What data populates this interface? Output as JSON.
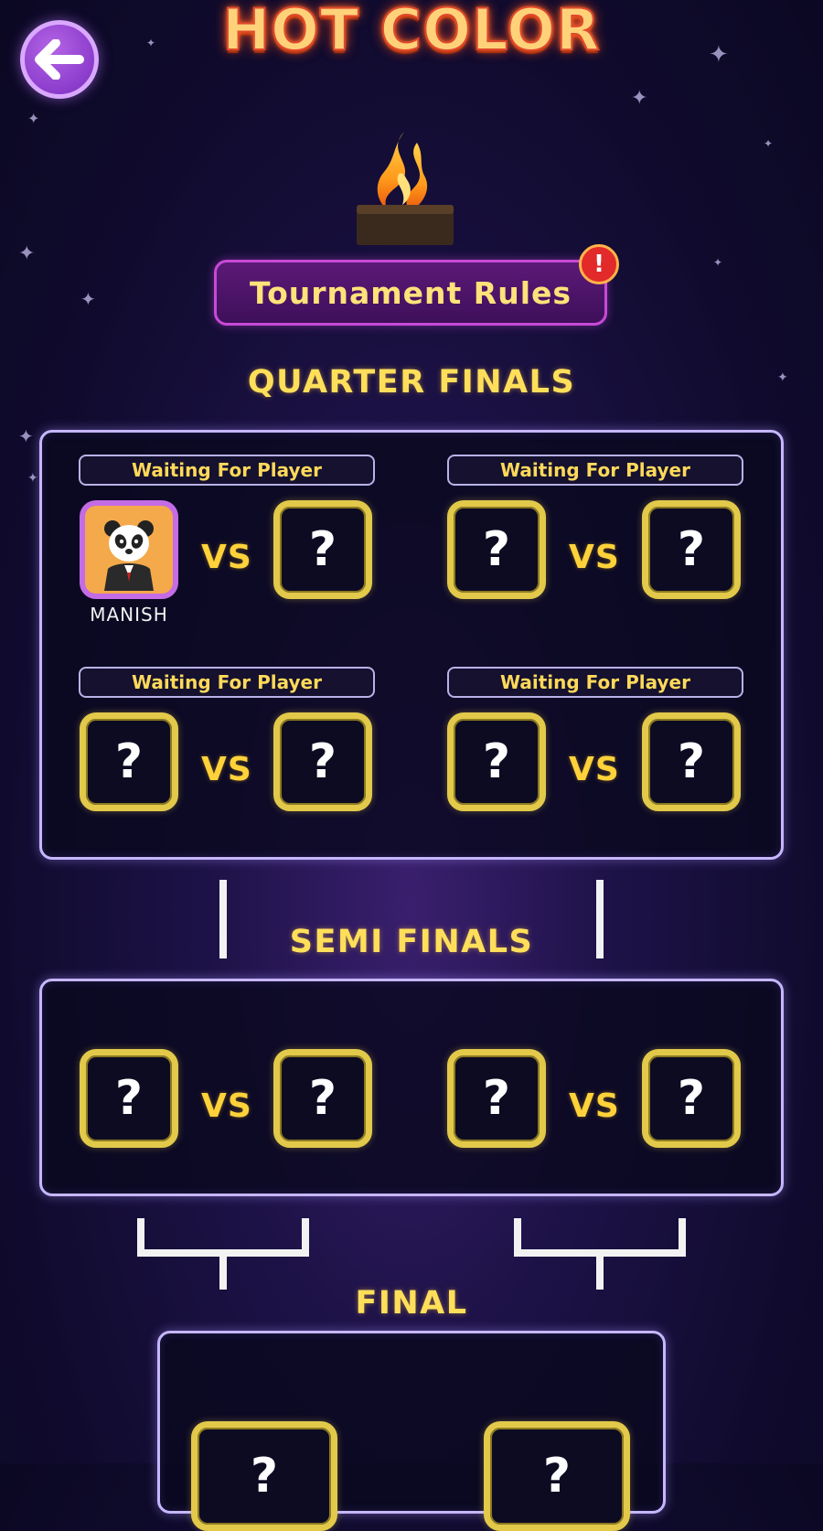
{
  "header": {
    "logo_text": "HOT COLOR",
    "back_icon": "arrow-left-icon",
    "trophy_icon": "flame-icon"
  },
  "rules": {
    "label": "Tournament Rules",
    "alert_symbol": "!"
  },
  "quarter_finals": {
    "title": "QUARTER FINALS",
    "matches": [
      {
        "status": "Waiting For Player",
        "player1": "MANISH",
        "player1_avatar": "panda-avatar",
        "player2": "?"
      },
      {
        "status": "Waiting For Player",
        "player1": "?",
        "player2": "?"
      },
      {
        "status": "Waiting For Player",
        "player1": "?",
        "player2": "?"
      },
      {
        "status": "Waiting For Player",
        "player1": "?",
        "player2": "?"
      }
    ]
  },
  "semi_finals": {
    "title": "SEMI FINALS",
    "matches": [
      {
        "player1": "?",
        "player2": "?"
      },
      {
        "player1": "?",
        "player2": "?"
      }
    ]
  },
  "final": {
    "title": "FINAL"
  },
  "labels": {
    "vs": "VS",
    "unknown": "?"
  },
  "colors": {
    "accent_yellow": "#ffdf5a",
    "slot_gold": "#e2c94a",
    "panel_border": "#c6b6ff",
    "rules_purple": "#5b1a78",
    "alert_red": "#e22a2a"
  }
}
